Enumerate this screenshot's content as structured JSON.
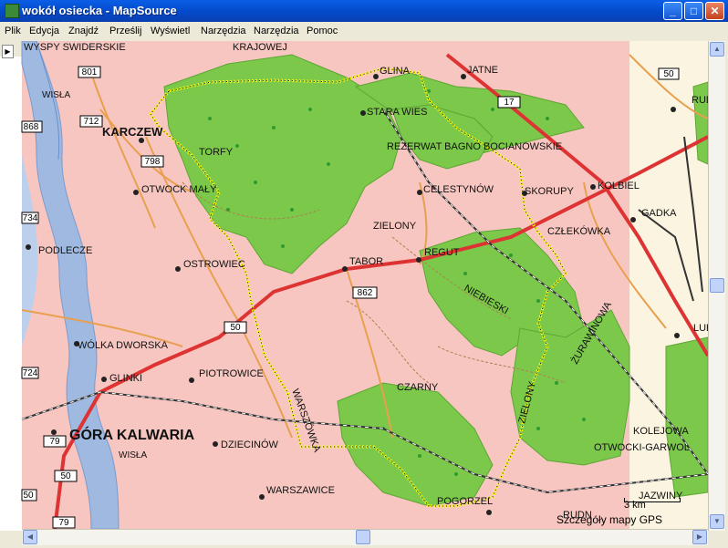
{
  "window": {
    "title": "wokół osiecka - MapSource",
    "minimize": "_",
    "maximize": "□",
    "close": "✕"
  },
  "menu": [
    "Plik",
    "Edycja",
    "Znajdź",
    "Prześlij",
    "Wyświetl",
    "Narzędzia",
    "Narzędzia",
    "Pomoc"
  ],
  "status": {
    "details": "Szczegóły mapy GPS",
    "scale": "3 km"
  },
  "map": {
    "top_partial_labels": [
      "WYSPY SWIDERSKIE",
      "KRAJOWEJ"
    ],
    "towns": [
      {
        "name": "KARCZEW"
      },
      {
        "name": "GLINA"
      },
      {
        "name": "JATNE"
      },
      {
        "name": "STARA WIES"
      },
      {
        "name": "REZERWAT BAGNO BOCIANOWSKIE"
      },
      {
        "name": "TORFY"
      },
      {
        "name": "OTWOCK MAŁY"
      },
      {
        "name": "CELESTYNÓW"
      },
      {
        "name": "SKORUPY"
      },
      {
        "name": "KOLBIEL"
      },
      {
        "name": "GADKA"
      },
      {
        "name": "ZIELONY"
      },
      {
        "name": "CZŁEKÓWKA"
      },
      {
        "name": "PODLECZE"
      },
      {
        "name": "OSTROWIEC"
      },
      {
        "name": "TABOR"
      },
      {
        "name": "REGUT"
      },
      {
        "name": "NIEBIESKI"
      },
      {
        "name": "ŻURAWINOWA"
      },
      {
        "name": "WÓLKA DWORSKA"
      },
      {
        "name": "GLINKI"
      },
      {
        "name": "PIOTROWICE"
      },
      {
        "name": "CZARNY"
      },
      {
        "name": "ZIELONY"
      },
      {
        "name": "WARSZÓWKA"
      },
      {
        "name": "GÓRA KALWARIA"
      },
      {
        "name": "WISŁA"
      },
      {
        "name": "WISŁA"
      },
      {
        "name": "DZIECINÓW"
      },
      {
        "name": "KOLEJOWA"
      },
      {
        "name": "OTWOCKI-GARWOL"
      },
      {
        "name": "WARSZAWICE"
      },
      {
        "name": "POGORZEL"
      },
      {
        "name": "JAZWINY"
      },
      {
        "name": "RUDN"
      },
      {
        "name": "LUB"
      },
      {
        "name": "RUDN"
      }
    ],
    "road_shields": [
      "801",
      "712",
      "798",
      "862",
      "50",
      "50",
      "79",
      "79",
      "50",
      "17",
      "868",
      "734",
      "724",
      "50"
    ]
  }
}
